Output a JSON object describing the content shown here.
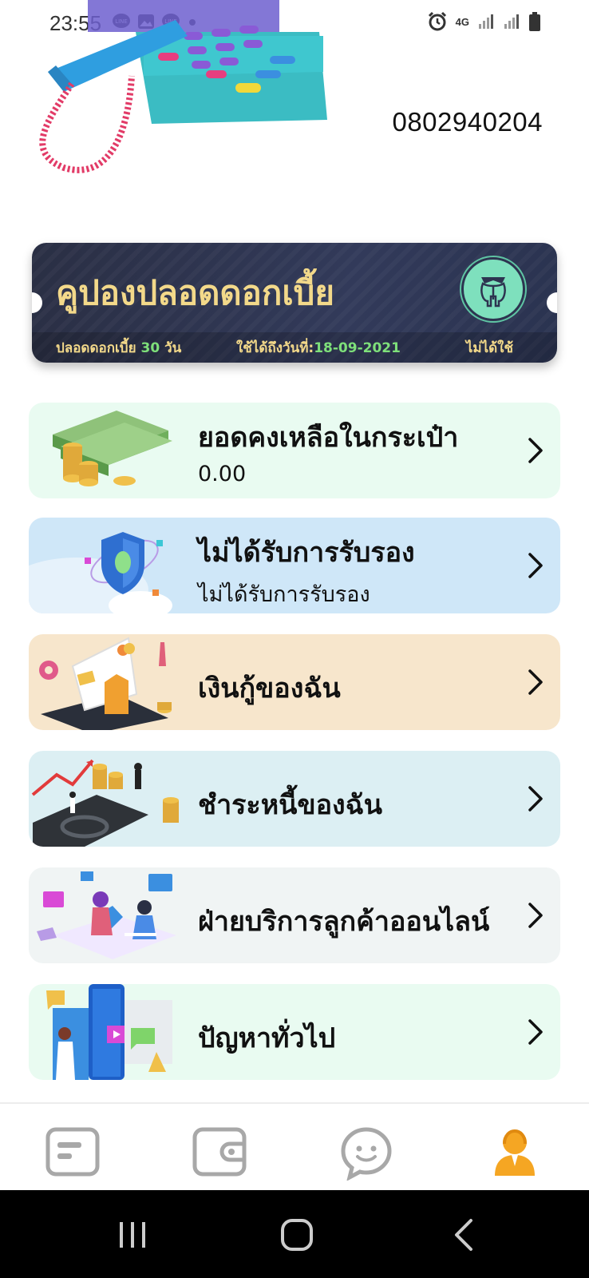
{
  "status_bar": {
    "time": "23:55",
    "left_icons": [
      "line-icon",
      "gallery-icon",
      "line-icon",
      "dot-icon"
    ],
    "right_icons": [
      "alarm-icon",
      "4g-icon",
      "signal-icon",
      "signal-icon",
      "battery-icon"
    ],
    "network": "4G"
  },
  "profile": {
    "phone_number": "0802940204"
  },
  "coupon": {
    "title": "คูปองปลอดดอกเบี้ย",
    "interest_free_prefix": "ปลอดดอกเบี้ย ",
    "interest_free_days": "30",
    "interest_free_suffix": " วัน",
    "valid_until_label": "ใช้ได้ถึงวันที่:",
    "valid_until_date": "18-09-2021",
    "status": "ไม่ได้ใช้",
    "colors": {
      "text": "#f3d98a",
      "accent": "#7ee07a",
      "bg": "#2a2f44"
    }
  },
  "menu": [
    {
      "title": "ยอดคงเหลือในกระเป๋า",
      "subtitle": "0.00",
      "bg": "#e9fbf1",
      "art": "money-stack-icon"
    },
    {
      "title": "ไม่ได้รับการรับรอง",
      "subtitle": "ไม่ได้รับการรับรอง",
      "bg": "#cfe7f8",
      "art": "shield-check-icon"
    },
    {
      "title": "เงินกู้ของฉัน",
      "subtitle": "",
      "bg": "#f7e6cc",
      "art": "credit-card-coins-icon"
    },
    {
      "title": "ชำระหนี้ของฉัน",
      "subtitle": "",
      "bg": "#dceff3",
      "art": "growth-chart-icon"
    },
    {
      "title": "ฝ่ายบริการลูกค้าออนไลน์",
      "subtitle": "",
      "bg": "#f0f4f4",
      "art": "customer-service-icon"
    },
    {
      "title": "ปัญหาทั่วไป",
      "subtitle": "",
      "bg": "#e9fbf1",
      "art": "faq-phone-icon"
    }
  ],
  "bottom_nav": [
    {
      "icon": "list-icon",
      "active": false
    },
    {
      "icon": "wallet-icon",
      "active": false
    },
    {
      "icon": "chat-icon",
      "active": false
    },
    {
      "icon": "user-icon",
      "active": true,
      "color": "#f5a623"
    }
  ],
  "system_nav": [
    "recent-apps-icon",
    "home-icon",
    "back-icon"
  ]
}
